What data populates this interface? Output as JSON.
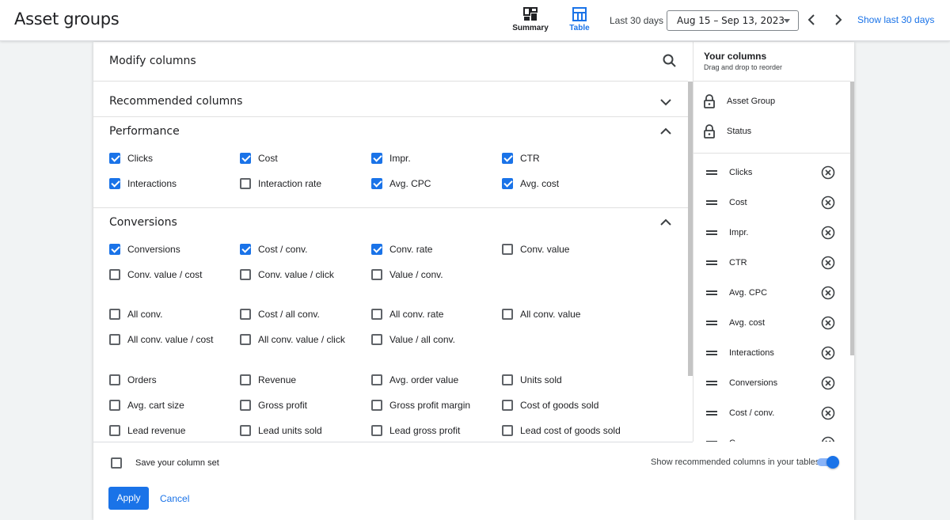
{
  "header": {
    "title": "Asset groups",
    "views": [
      {
        "label": "Summary",
        "icon": "dashboard-icon"
      },
      {
        "label": "Table",
        "icon": "table-icon"
      }
    ],
    "range_label": "Last 30 days",
    "date_range": "Aug 15 – Sep 13, 2023",
    "show_last_link": "Show last 30 days"
  },
  "dialog": {
    "title": "Modify columns",
    "sections": {
      "recommended": "Recommended columns",
      "performance": "Performance",
      "conversions": "Conversions"
    },
    "performance_items": [
      {
        "label": "Clicks",
        "checked": true
      },
      {
        "label": "Cost",
        "checked": true
      },
      {
        "label": "Impr.",
        "checked": true
      },
      {
        "label": "CTR",
        "checked": true
      },
      {
        "label": "Interactions",
        "checked": true
      },
      {
        "label": "Interaction rate",
        "checked": false
      },
      {
        "label": "Avg. CPC",
        "checked": true
      },
      {
        "label": "Avg. cost",
        "checked": true
      }
    ],
    "conversion_items": [
      {
        "label": "Conversions",
        "checked": true
      },
      {
        "label": "Cost / conv.",
        "checked": true
      },
      {
        "label": "Conv. rate",
        "checked": true
      },
      {
        "label": "Conv. value",
        "checked": false
      },
      {
        "label": "Conv. value / cost",
        "checked": false
      },
      {
        "label": "Conv. value / click",
        "checked": false
      },
      {
        "label": "Value / conv.",
        "checked": false
      },
      {
        "label": "All conv.",
        "checked": false
      },
      {
        "label": "Cost / all conv.",
        "checked": false
      },
      {
        "label": "All conv. rate",
        "checked": false
      },
      {
        "label": "All conv. value",
        "checked": false
      },
      {
        "label": "All conv. value / cost",
        "checked": false
      },
      {
        "label": "All conv. value / click",
        "checked": false
      },
      {
        "label": "Value / all conv.",
        "checked": false
      },
      {
        "label": "Orders",
        "checked": false
      },
      {
        "label": "Revenue",
        "checked": false
      },
      {
        "label": "Avg. order value",
        "checked": false
      },
      {
        "label": "Units sold",
        "checked": false
      },
      {
        "label": "Avg. cart size",
        "checked": false
      },
      {
        "label": "Gross profit",
        "checked": false
      },
      {
        "label": "Gross profit margin",
        "checked": false
      },
      {
        "label": "Cost of goods sold",
        "checked": false
      },
      {
        "label": "Lead revenue",
        "checked": false
      },
      {
        "label": "Lead units sold",
        "checked": false
      },
      {
        "label": "Lead gross profit",
        "checked": false
      },
      {
        "label": "Lead cost of goods sold",
        "checked": false
      }
    ],
    "save_label": "Save your column set",
    "toggle_label": "Show recommended columns in your tables",
    "toggle_on": true,
    "apply_label": "Apply",
    "cancel_label": "Cancel"
  },
  "your_columns": {
    "title": "Your columns",
    "subtitle": "Drag and drop to reorder",
    "fixed": [
      "Asset Group",
      "Status"
    ],
    "items": [
      "Clicks",
      "Cost",
      "Impr.",
      "CTR",
      "Avg. CPC",
      "Avg. cost",
      "Interactions",
      "Conversions",
      "Cost / conv.",
      "C"
    ]
  },
  "colors": {
    "accent": "#1a73e8",
    "toggle_track": "#8ab4f8"
  }
}
